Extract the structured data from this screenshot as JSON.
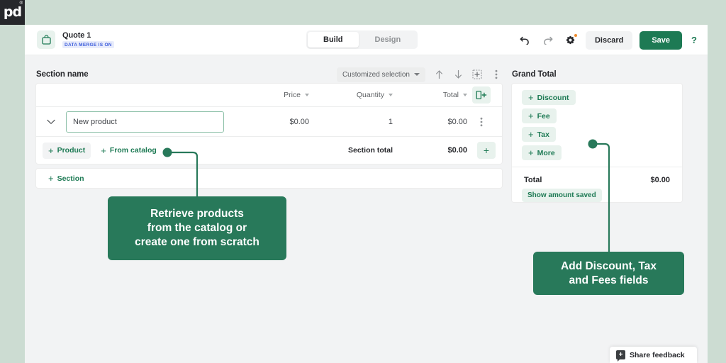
{
  "brand": {
    "logo_text": "pd",
    "logo_trademark": "®",
    "accent_green": "#1d7a54",
    "callout_green": "#28795a",
    "badge_orange": "#f08c2e",
    "merge_blue": "#3b5bdb"
  },
  "topbar": {
    "doc_icon": "shopping-bag-icon",
    "doc_title": "Quote 1",
    "merge_badge": "DATA MERGE IS ON",
    "segments": [
      {
        "label": "Build",
        "active": true
      },
      {
        "label": "Design",
        "active": false
      }
    ],
    "undo_icon": "undo-icon",
    "redo_icon": "redo-icon",
    "settings_icon": "gear-icon",
    "settings_has_badge": true,
    "discard_label": "Discard",
    "save_label": "Save",
    "help_label": "?"
  },
  "left_panel": {
    "title": "Section name",
    "selection_label": "Customized selection",
    "tools": [
      {
        "icon": "arrow-up-icon",
        "name": "move-section-up"
      },
      {
        "icon": "arrow-down-icon",
        "name": "move-section-down"
      },
      {
        "icon": "add-section-icon",
        "name": "insert-section"
      },
      {
        "icon": "kebab-menu-icon",
        "name": "section-more-menu"
      }
    ],
    "table": {
      "columns": [
        {
          "label": "",
          "key": "name",
          "sortable": false
        },
        {
          "label": "Price",
          "key": "price",
          "sortable": true
        },
        {
          "label": "Quantity",
          "key": "quantity",
          "sortable": true
        },
        {
          "label": "Total",
          "key": "total",
          "sortable": true
        }
      ],
      "add_column_icon": "add-column-icon",
      "rows": [
        {
          "expand_icon": "chevron-down-icon",
          "name_value": "New product",
          "name_placeholder": "New product",
          "price": "$0.00",
          "quantity": "1",
          "total": "$0.00",
          "row_menu_icon": "kebab-menu-icon"
        }
      ],
      "footer": {
        "add_product_label": "Product",
        "add_from_catalog_label": "From catalog",
        "section_total_label": "Section total",
        "section_total_value": "$0.00",
        "add_row_label": "+"
      }
    },
    "add_section_label": "Section"
  },
  "right_panel": {
    "title": "Grand Total",
    "field_buttons": [
      {
        "label": "Discount"
      },
      {
        "label": "Fee"
      },
      {
        "label": "Tax"
      },
      {
        "label": "More"
      }
    ],
    "total_label": "Total",
    "total_value": "$0.00",
    "show_amount_saved_label": "Show amount saved"
  },
  "annotations": [
    {
      "id": "callout-catalog",
      "text": "Retrieve products from the catalog or create one from scratch",
      "lines": [
        "Retrieve products",
        "from the catalog or",
        "create one from scratch"
      ]
    },
    {
      "id": "callout-fields",
      "text": "Add Discount, Tax and Fees fields",
      "lines": [
        "Add Discount, Tax",
        "and Fees fields"
      ]
    }
  ],
  "feedback": {
    "label": "Share feedback",
    "icon": "feedback-bubble-icon"
  }
}
